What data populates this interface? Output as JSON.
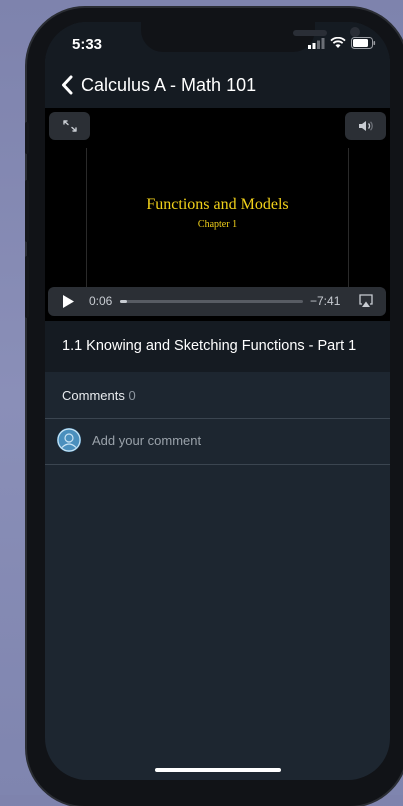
{
  "status_bar": {
    "time": "5:33"
  },
  "header": {
    "back_icon": "chevron-left-icon",
    "title": "Calculus A - Math 101"
  },
  "video": {
    "fullscreen_icon": "expand-icon",
    "volume_icon": "speaker-icon",
    "slide_title": "Functions and Models",
    "slide_subtitle": "Chapter 1",
    "slide_text_color": "#f2d21a",
    "controls": {
      "play_icon": "play-icon",
      "elapsed": "0:06",
      "remaining": "−7:41",
      "progress_fraction": 0.013,
      "airplay_icon": "airplay-icon"
    }
  },
  "lecture": {
    "title": "1.1 Knowing and Sketching Functions - Part 1"
  },
  "comments": {
    "label": "Comments",
    "count": "0",
    "add_placeholder": "Add your comment",
    "avatar_color": "#4a8fbd"
  }
}
